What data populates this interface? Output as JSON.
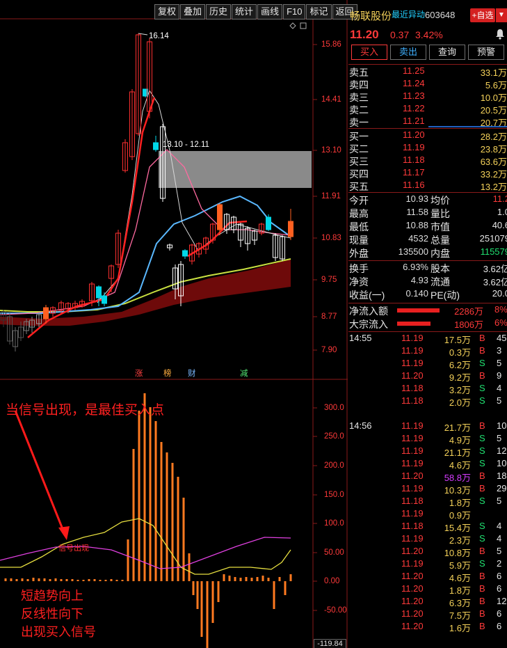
{
  "toolbar": [
    "复权",
    "叠加",
    "历史",
    "统计",
    "画线",
    "F10",
    "标记",
    "返回"
  ],
  "price_axis": [
    "15.86",
    "14.41",
    "13.10",
    "11.91",
    "10.83",
    "9.75",
    "8.77",
    "7.90"
  ],
  "indicator_axis": [
    "300.0",
    "250.0",
    "200.0",
    "150.0",
    "100.0",
    "50.00",
    "0.00",
    "-50.00"
  ],
  "indicator_low": "-119.84",
  "chart_labels": {
    "high_marker": "16.14",
    "range_box": "13.10 - 12.11"
  },
  "event_tags": [
    {
      "text": "涨",
      "color": "#ff4040"
    },
    {
      "text": "榜",
      "color": "#ffae40"
    },
    {
      "text": "财",
      "color": "#7ab8ff"
    },
    {
      "text": "减",
      "color": "#50e070"
    }
  ],
  "annotations": {
    "main": "当信号出现，是最佳买入点",
    "signal": "信号出现",
    "bottom": [
      "短趋势向上",
      "反线性向下",
      "出现买入信号"
    ]
  },
  "stock": {
    "name": "畅联股份",
    "tag": "最近异动",
    "code": "603648",
    "add_fav": "+自选",
    "price": "11.20",
    "change": "0.37",
    "change_pct": "3.42%"
  },
  "trade_buttons": [
    "买入",
    "卖出",
    "查询",
    "预警"
  ],
  "asks": [
    {
      "label": "卖五",
      "price": "11.25",
      "vol": "33.1万"
    },
    {
      "label": "卖四",
      "price": "11.24",
      "vol": "5.6万"
    },
    {
      "label": "卖三",
      "price": "11.23",
      "vol": "10.0万"
    },
    {
      "label": "卖二",
      "price": "11.22",
      "vol": "20.5万"
    },
    {
      "label": "卖一",
      "price": "11.21",
      "vol": "20.7万"
    }
  ],
  "bids": [
    {
      "label": "买一",
      "price": "11.20",
      "vol": "28.2万"
    },
    {
      "label": "买二",
      "price": "11.19",
      "vol": "23.8万"
    },
    {
      "label": "买三",
      "price": "11.18",
      "vol": "63.6万"
    },
    {
      "label": "买四",
      "price": "11.17",
      "vol": "33.2万"
    },
    {
      "label": "买五",
      "price": "11.16",
      "vol": "13.2万"
    }
  ],
  "stats": [
    {
      "l1": "今开",
      "v1": "10.93",
      "c1": "#ff3a3a",
      "l2": "均价",
      "v2": "11.2"
    },
    {
      "l1": "最高",
      "v1": "11.58",
      "c1": "#ff3a3a",
      "l2": "量比",
      "v2": "1.0"
    },
    {
      "l1": "最低",
      "v1": "10.88",
      "c1": "#ff3a3a",
      "l2": "市值",
      "v2": "40.6"
    },
    {
      "l1": "现量",
      "v1": "4532",
      "c1": "#d63cff",
      "l2": "总量",
      "v2": "251079"
    },
    {
      "l1": "外盘",
      "v1": "135500",
      "c1": "#ff3a3a",
      "l2": "内盘",
      "v2": "115579"
    },
    {
      "l1": "换手",
      "v1": "6.93%",
      "c1": "#e6e6e6",
      "l2": "股本",
      "v2": "3.62亿"
    },
    {
      "l1": "净资",
      "v1": "4.93",
      "c1": "#e6e6e6",
      "l2": "流通",
      "v2": "3.62亿"
    },
    {
      "l1": "收益(一)",
      "v1": "0.140",
      "c1": "#e6e6e6",
      "l2": "PE(动)",
      "v2": "20.0"
    }
  ],
  "flows": [
    {
      "label": "净流入额",
      "amount": "2286万",
      "pct": "8%",
      "bar": 0.87
    },
    {
      "label": "大宗流入",
      "amount": "1806万",
      "pct": "6%",
      "bar": 0.68
    }
  ],
  "ticks": [
    {
      "time": "14:55",
      "price": "11.19",
      "vol": "17.5万",
      "side": "B",
      "cnt": "45"
    },
    {
      "time": "",
      "price": "11.19",
      "vol": "0.3万",
      "side": "B",
      "cnt": "3"
    },
    {
      "time": "",
      "price": "11.19",
      "vol": "6.2万",
      "side": "S",
      "cnt": "5"
    },
    {
      "time": "",
      "price": "11.20",
      "vol": "9.2万",
      "side": "B",
      "cnt": "9"
    },
    {
      "time": "",
      "price": "11.18",
      "vol": "3.2万",
      "side": "S",
      "cnt": "4"
    },
    {
      "time": "",
      "price": "11.18",
      "vol": "2.0万",
      "side": "S",
      "cnt": "5"
    },
    {
      "time": "14:56",
      "price": "11.19",
      "vol": "21.7万",
      "side": "B",
      "cnt": "10"
    },
    {
      "time": "",
      "price": "11.19",
      "vol": "4.9万",
      "side": "S",
      "cnt": "5"
    },
    {
      "time": "",
      "price": "11.19",
      "vol": "21.1万",
      "side": "S",
      "cnt": "12"
    },
    {
      "time": "",
      "price": "11.19",
      "vol": "4.6万",
      "side": "S",
      "cnt": "10"
    },
    {
      "time": "",
      "price": "11.20",
      "vol": "58.8万",
      "side": "B",
      "cnt": "18",
      "big": true
    },
    {
      "time": "",
      "price": "11.19",
      "vol": "10.3万",
      "side": "B",
      "cnt": "29"
    },
    {
      "time": "",
      "price": "11.18",
      "vol": "1.8万",
      "side": "S",
      "cnt": "5"
    },
    {
      "time": "",
      "price": "11.19",
      "vol": "0.9万",
      "side": "",
      "cnt": ""
    },
    {
      "time": "",
      "price": "11.18",
      "vol": "15.4万",
      "side": "S",
      "cnt": "4"
    },
    {
      "time": "",
      "price": "11.19",
      "vol": "2.3万",
      "side": "S",
      "cnt": "4"
    },
    {
      "time": "",
      "price": "11.20",
      "vol": "10.8万",
      "side": "B",
      "cnt": "5"
    },
    {
      "time": "",
      "price": "11.19",
      "vol": "5.9万",
      "side": "S",
      "cnt": "2"
    },
    {
      "time": "",
      "price": "11.20",
      "vol": "4.6万",
      "side": "B",
      "cnt": "6"
    },
    {
      "time": "",
      "price": "11.20",
      "vol": "1.8万",
      "side": "B",
      "cnt": "6"
    },
    {
      "time": "",
      "price": "11.20",
      "vol": "6.3万",
      "side": "B",
      "cnt": "12"
    },
    {
      "time": "",
      "price": "11.20",
      "vol": "7.5万",
      "side": "B",
      "cnt": "6"
    },
    {
      "time": "",
      "price": "11.20",
      "vol": "1.6万",
      "side": "B",
      "cnt": "6"
    }
  ]
}
